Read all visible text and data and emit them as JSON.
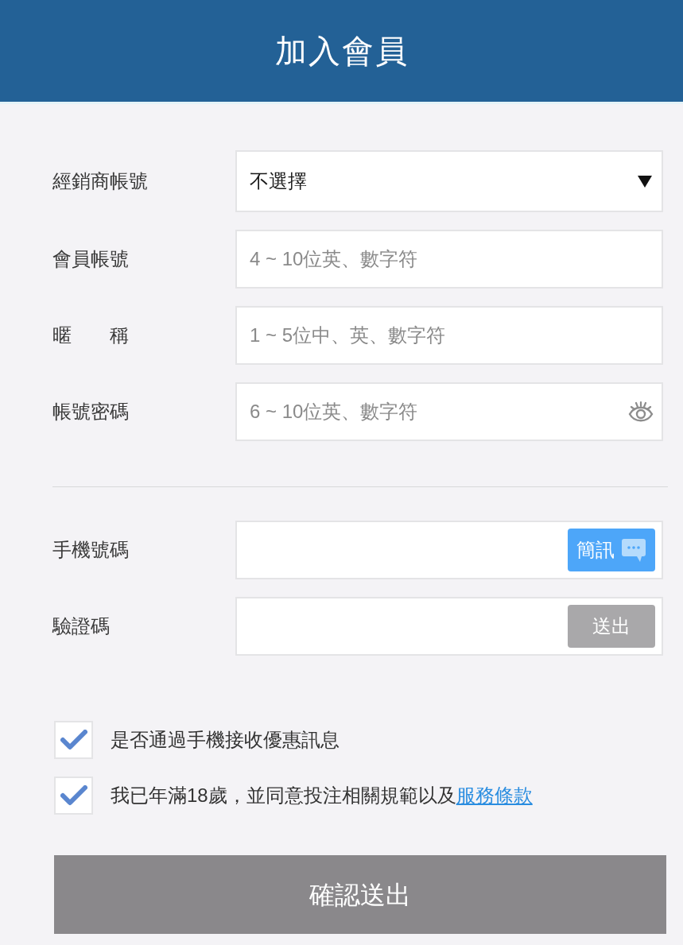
{
  "header": {
    "title": "加入會員"
  },
  "account_fields": [
    {
      "kind": "select",
      "label": "經銷商帳號",
      "value": "不選擇"
    },
    {
      "kind": "text",
      "label": "會員帳號",
      "placeholder": "4 ~ 10位英、數字符"
    },
    {
      "kind": "text",
      "label": "暱　　稱",
      "placeholder": "1 ~ 5位中、英、數字符"
    },
    {
      "kind": "password",
      "label": "帳號密碼",
      "placeholder": "6 ~ 10位英、數字符"
    }
  ],
  "phone_fields": [
    {
      "label": "手機號碼",
      "button": {
        "kind": "sms",
        "label": "簡訊",
        "disabled": false
      }
    },
    {
      "label": "驗證碼",
      "button": {
        "kind": "plain",
        "label": "送出",
        "disabled": true
      }
    }
  ],
  "agreements": [
    {
      "checked": true,
      "text": "是否通過手機接收優惠訊息"
    },
    {
      "checked": true,
      "text": "我已年滿18歲，並同意投注相關規範以及",
      "link": "服務條款"
    }
  ],
  "submit": {
    "label": "確認送出",
    "disabled": true
  }
}
